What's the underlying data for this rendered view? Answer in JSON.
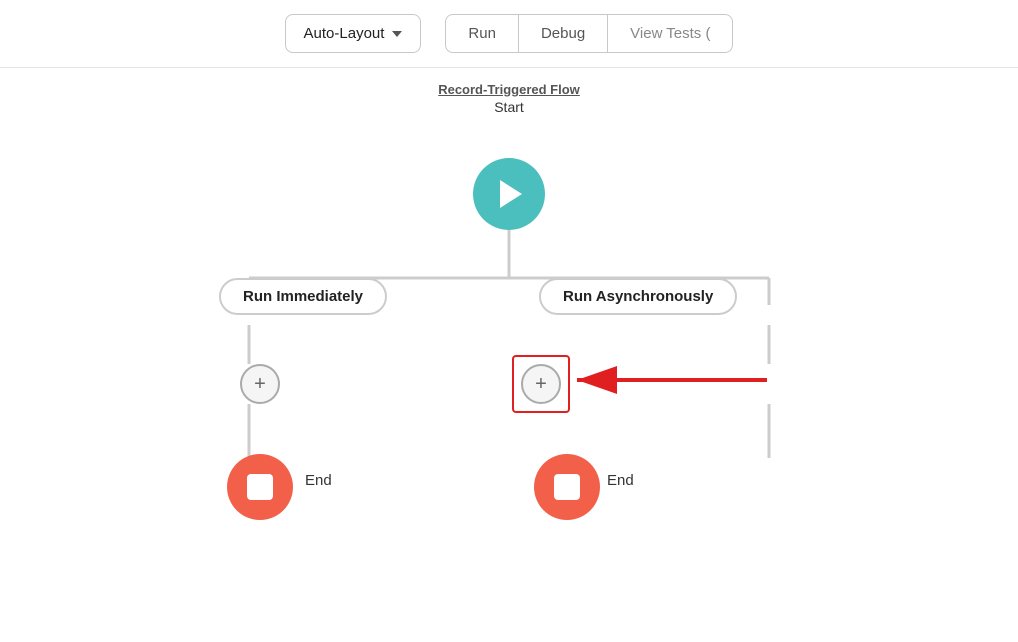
{
  "toolbar": {
    "auto_layout_label": "Auto-Layout",
    "run_label": "Run",
    "debug_label": "Debug",
    "view_tests_label": "View Tests ("
  },
  "flow": {
    "title": "Record-Triggered Flow",
    "subtitle": "Start",
    "branch_left": "Run Immediately",
    "branch_right": "Run Asynchronously",
    "end_label_left": "End",
    "end_label_right": "End"
  },
  "icons": {
    "chevron_down": "▼",
    "plus": "+",
    "play": "▶"
  },
  "colors": {
    "teal": "#4bbfbe",
    "coral": "#f2604a",
    "red_arrow": "#e02020",
    "border_gray": "#c8c8c8"
  }
}
